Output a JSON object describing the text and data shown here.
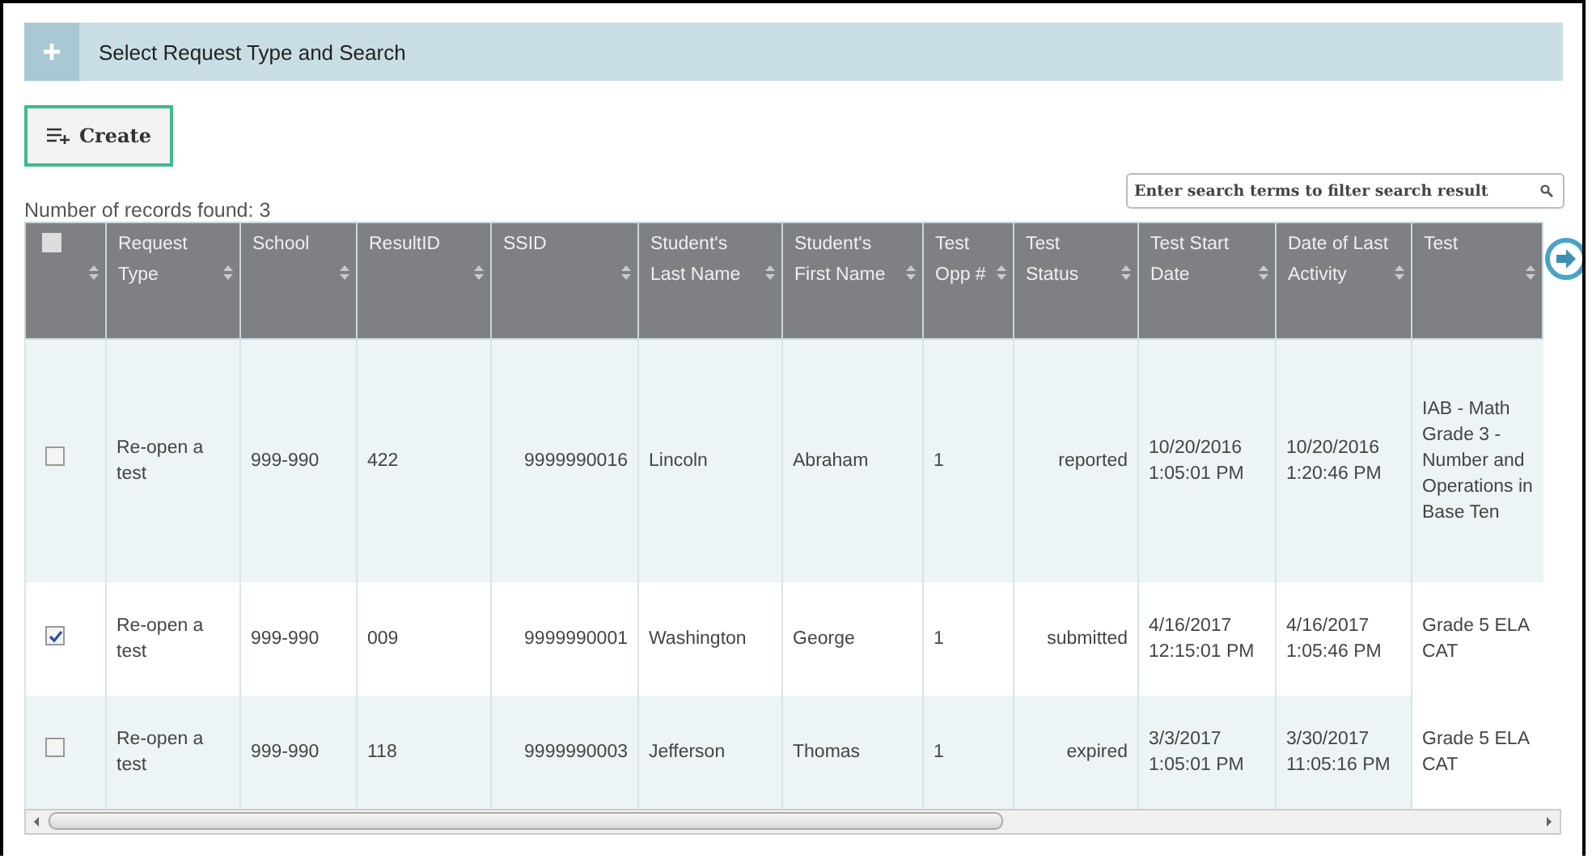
{
  "panel": {
    "title": "Select Request Type and Search"
  },
  "create_button": {
    "label": "Create"
  },
  "records_found": "Number of records found: 3",
  "search": {
    "placeholder": "Enter search terms to filter search result"
  },
  "table": {
    "select_all": {
      "checked": false
    },
    "columns": [
      "Request Type",
      "School",
      "ResultID",
      "SSID",
      "Student's Last Name",
      "Student's First Name",
      "Test Opp #",
      "Test Status",
      "Test Start Date",
      "Date of Last Activity",
      "Test"
    ],
    "rows": [
      {
        "checked": false,
        "cells": [
          "Re-open a test",
          "999-990",
          "422",
          "9999990016",
          "Lincoln",
          "Abraham",
          "1",
          "reported",
          "10/20/2016 1:05:01 PM",
          "10/20/2016 1:20:46 PM",
          "IAB - Math Grade 3 - Number and Operations in Base Ten"
        ]
      },
      {
        "checked": true,
        "cells": [
          "Re-open a test",
          "999-990",
          "009",
          "9999990001",
          "Washington",
          "George",
          "1",
          "submitted",
          "4/16/2017 12:15:01 PM",
          "4/16/2017 1:05:46 PM",
          "Grade 5 ELA CAT"
        ]
      },
      {
        "checked": false,
        "cells": [
          "Re-open a test",
          "999-990",
          "118",
          "9999990003",
          "Jefferson",
          "Thomas",
          "1",
          "expired",
          "3/3/2017 1:05:01 PM",
          "3/30/2017 11:05:16 PM",
          "Grade 5 ELA CAT"
        ]
      }
    ]
  }
}
